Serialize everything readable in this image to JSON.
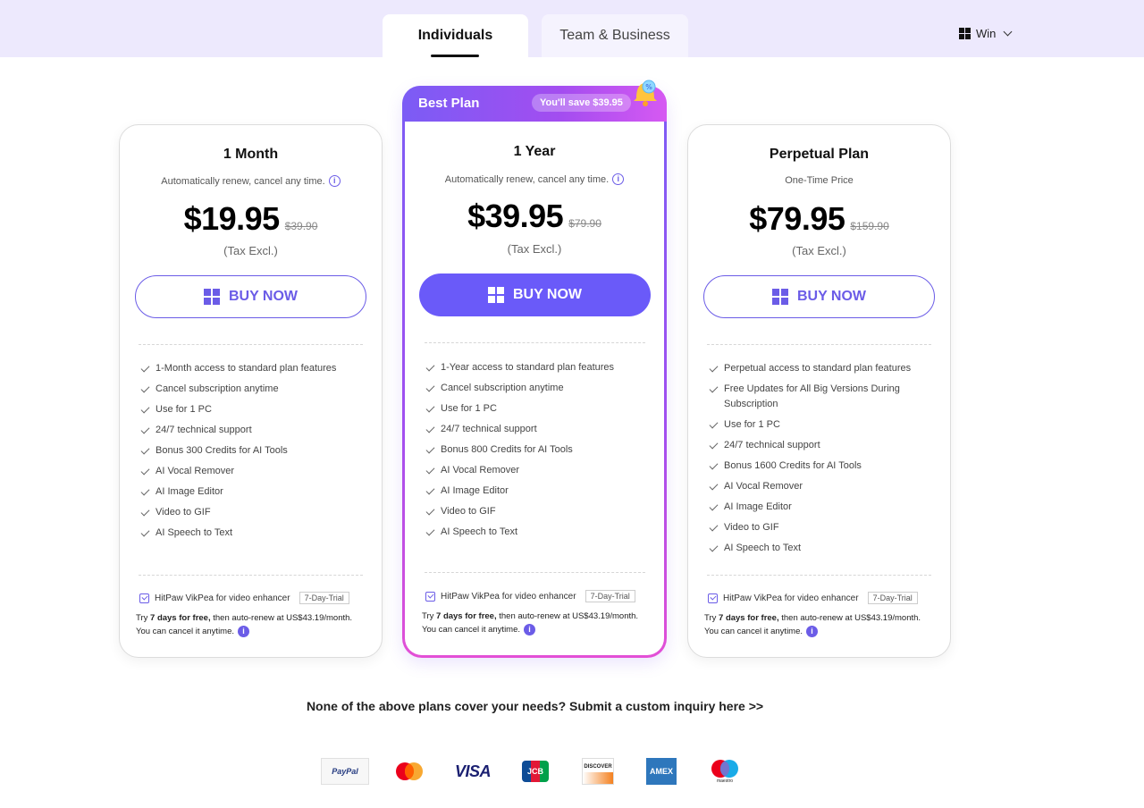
{
  "tabs": {
    "individuals": "Individuals",
    "team": "Team & Business"
  },
  "os_select": {
    "value": "Win"
  },
  "plans": [
    {
      "title": "1 Month",
      "subtitle": "Automatically renew, cancel any time.",
      "price": "$19.95",
      "old_price": "$39.90",
      "tax": "(Tax Excl.)",
      "buy_label": "BUY NOW",
      "features": [
        "1-Month access to standard plan features",
        "Cancel subscription anytime",
        "Use for 1 PC",
        "24/7 technical support",
        "Bonus 300 Credits for AI Tools",
        "AI Vocal Remover",
        "AI Image Editor",
        "Video to GIF",
        "AI Speech to Text"
      ],
      "addon": "HitPaw VikPea for video enhancer",
      "trial_badge": "7-Day-Trial",
      "trial_pre": "Try ",
      "trial_bold": "7 days for free,",
      "trial_rest": " then auto-renew at US$43.19/month.",
      "trial_cancel": "You can cancel it anytime."
    },
    {
      "best_label": "Best Plan",
      "save_label": "You'll save $39.95",
      "title": "1 Year",
      "subtitle": "Automatically renew, cancel any time.",
      "price": "$39.95",
      "old_price": "$79.90",
      "tax": "(Tax Excl.)",
      "buy_label": "BUY NOW",
      "features": [
        "1-Year access to standard plan features",
        "Cancel subscription anytime",
        "Use for 1 PC",
        "24/7 technical support",
        "Bonus 800 Credits for AI Tools",
        "AI Vocal Remover",
        "AI Image Editor",
        "Video to GIF",
        "AI Speech to Text"
      ],
      "addon": "HitPaw VikPea for video enhancer",
      "trial_badge": "7-Day-Trial",
      "trial_pre": "Try ",
      "trial_bold": "7 days for free,",
      "trial_rest": " then auto-renew at US$43.19/month.",
      "trial_cancel": "You can cancel it anytime."
    },
    {
      "title": "Perpetual Plan",
      "subtitle": "One-Time Price",
      "price": "$79.95",
      "old_price": "$159.90",
      "tax": "(Tax Excl.)",
      "buy_label": "BUY NOW",
      "features": [
        "Perpetual access to standard plan features",
        "Free Updates for All Big Versions During Subscription",
        "Use for 1 PC",
        "24/7 technical support",
        "Bonus 1600 Credits for AI Tools",
        "AI Vocal Remover",
        "AI Image Editor",
        "Video to GIF",
        "AI Speech to Text"
      ],
      "addon": "HitPaw VikPea for video enhancer",
      "trial_badge": "7-Day-Trial",
      "trial_pre": "Try ",
      "trial_bold": "7 days for free,",
      "trial_rest": " then auto-renew at US$43.19/month.",
      "trial_cancel": "You can cancel it anytime."
    }
  ],
  "inquiry_text": "None of the above plans cover your needs? Submit a custom inquiry here >>",
  "payment_methods": {
    "paypal": "PayPal",
    "mastercard_icon": "mastercard-icon",
    "visa": "VISA",
    "jcb": "JCB",
    "discover": "DISCOVER",
    "amex": "AMEX",
    "maestro": "maestro"
  },
  "colors": {
    "accent": "#6a5af9",
    "band": "#ede9fd"
  }
}
